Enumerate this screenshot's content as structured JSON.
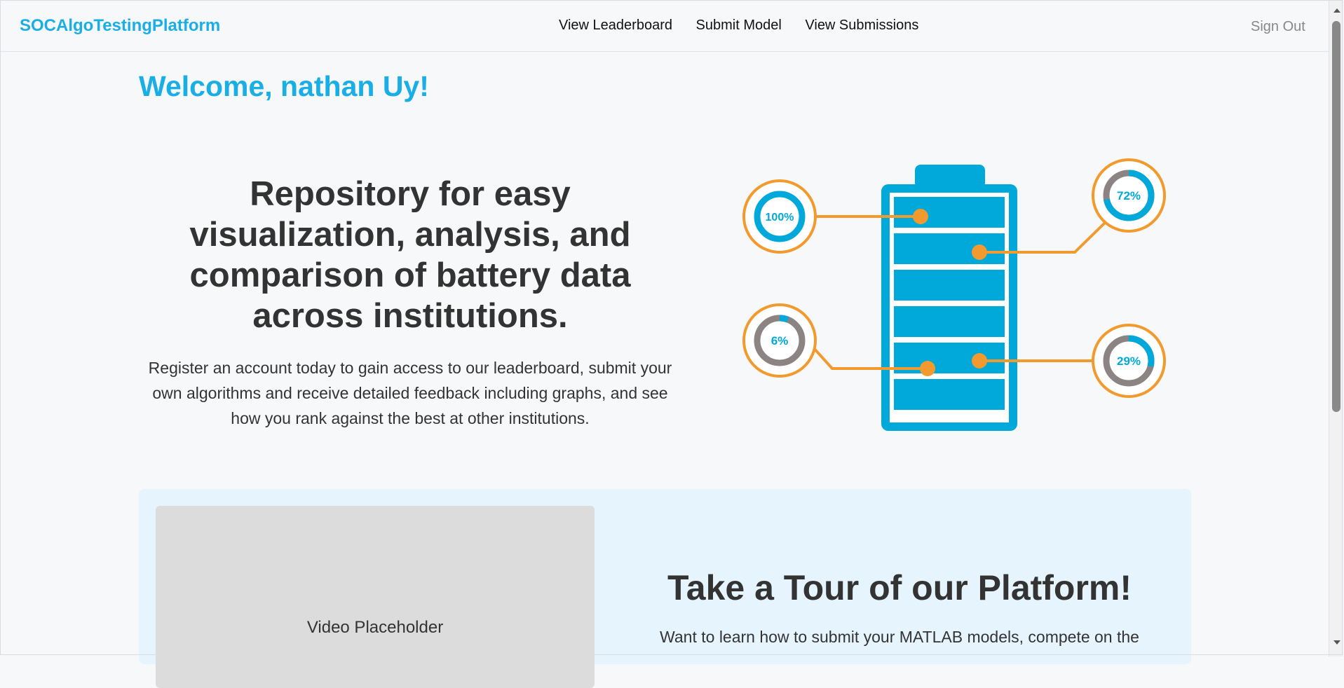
{
  "header": {
    "brand": "SOCAlgoTestingPlatform",
    "nav": [
      "View Leaderboard",
      "Submit Model",
      "View Submissions"
    ],
    "sign_out": "Sign Out"
  },
  "welcome": "Welcome, nathan Uy!",
  "hero": {
    "title": "Repository for easy visualization, analysis, and comparison of battery data across institutions.",
    "description": "Register an account today to gain access to our leaderboard, submit your own algorithms and receive detailed feedback including graphs, and see how you rank against the best at other institutions."
  },
  "battery": {
    "gauges": [
      {
        "label": "100%",
        "value": 1.0
      },
      {
        "label": "72%",
        "value": 0.72
      },
      {
        "label": "6%",
        "value": 0.06
      },
      {
        "label": "29%",
        "value": 0.29
      }
    ],
    "colors": {
      "battery": "#00a9d9",
      "accent": "#f29a2e",
      "gauge_bg": "#8c8383"
    }
  },
  "tour": {
    "video_placeholder": "Video Placeholder",
    "title": "Take a Tour of our Platform!",
    "text": "Want to learn how to submit your MATLAB models, compete on the"
  },
  "colors": {
    "brand": "#1aaee6",
    "tour_bg": "#e6f4fd"
  }
}
